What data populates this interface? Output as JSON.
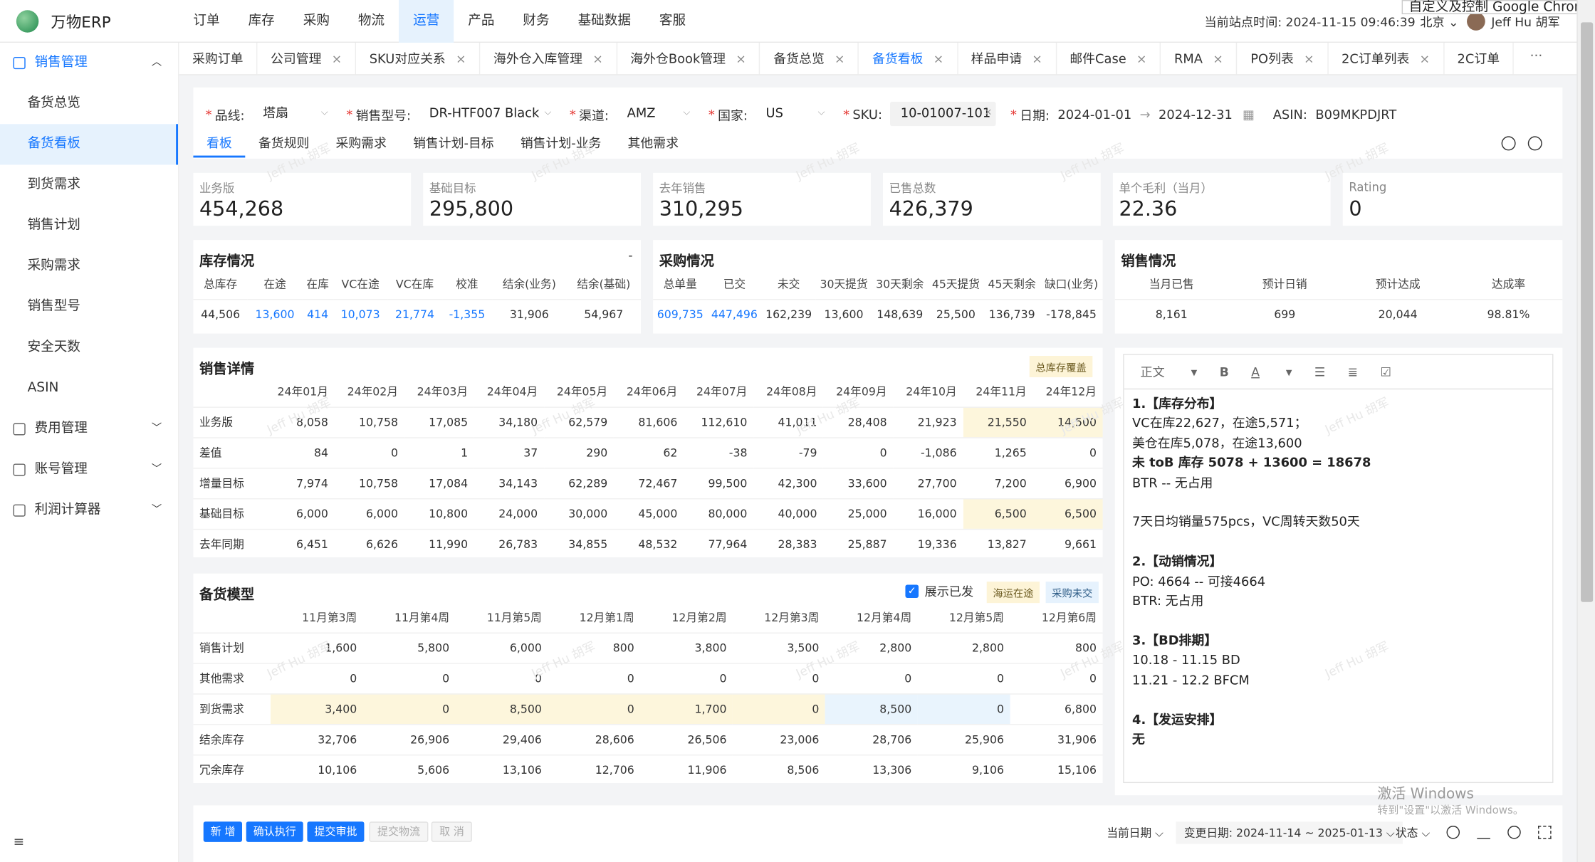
{
  "app": {
    "brand": "万物ERP",
    "site_time": "当前站点时间: 2024-11-15 09:46:39",
    "location": "北京",
    "user": "Jeff Hu 胡军",
    "chrome_tip": "自定义及控制 Google Chrome",
    "accent": "#1677ff"
  },
  "nav": [
    "订单",
    "库存",
    "采购",
    "物流",
    "运营",
    "产品",
    "财务",
    "基础数据",
    "客服"
  ],
  "nav_active": "运营",
  "sidebar": {
    "group1": "销售管理",
    "items": [
      "备货总览",
      "备货看板",
      "到货需求",
      "销售计划",
      "采购需求",
      "销售型号",
      "安全天数",
      "ASIN"
    ],
    "group2": "费用管理",
    "group3": "账号管理",
    "group4": "利润计算器",
    "collapse_icon": "≡"
  },
  "tabs": [
    "采购订单",
    "公司管理",
    "SKU对应关系",
    "海外仓入库管理",
    "海外仓Book管理",
    "备货总览",
    "备货看板",
    "样品申请",
    "邮件Case",
    "RMA",
    "PO列表",
    "2C订单列表",
    "2C订单"
  ],
  "tabs_more": "···",
  "filters": {
    "line_label": "品线:",
    "line": "塔扇",
    "model_label": "销售型号:",
    "model": "DR-HTF007 Black",
    "channel_label": "渠道:",
    "channel": "AMZ",
    "country_label": "国家:",
    "country": "US",
    "sku_label": "SKU:",
    "sku": "10-01007-101",
    "date_label": "日期:",
    "date_from": "2024-01-01",
    "date_to": "2024-12-31",
    "asin_label": "ASIN:",
    "asin": "B09MKPDJRT"
  },
  "subtabs": [
    "看板",
    "备货规则",
    "采购需求",
    "销售计划-目标",
    "销售计划-业务",
    "其他需求"
  ],
  "kpis": [
    {
      "label": "业务版",
      "value": "454,268"
    },
    {
      "label": "基础目标",
      "value": "295,800"
    },
    {
      "label": "去年销售",
      "value": "310,295"
    },
    {
      "label": "已售总数",
      "value": "426,379"
    },
    {
      "label": "单个毛利（当月）",
      "value": "22.36"
    },
    {
      "label": "Rating",
      "value": "0"
    }
  ],
  "inventory": {
    "title": "库存情况",
    "dash": "-",
    "headers": [
      "总库存",
      "在途",
      "在库",
      "VC在途",
      "VC在库",
      "校准",
      "结余(业务)",
      "结余(基础)"
    ],
    "values": [
      "44,506",
      "13,600",
      "414",
      "10,073",
      "21,774",
      "-1,355",
      "31,906",
      "54,967"
    ]
  },
  "purchase": {
    "title": "采购情况",
    "headers": [
      "总单量",
      "已交",
      "未交",
      "30天提货",
      "30天剩余",
      "45天提货",
      "45天剩余",
      "缺口(业务)"
    ],
    "values": [
      "609,735",
      "447,496",
      "162,239",
      "13,600",
      "148,639",
      "25,500",
      "136,739",
      "-178,845"
    ]
  },
  "sales": {
    "title": "销售情况",
    "headers": [
      "当月已售",
      "预计日销",
      "预计达成",
      "达成率"
    ],
    "values": [
      "8,161",
      "699",
      "20,044",
      "98.81%"
    ]
  },
  "detail": {
    "title": "销售详情",
    "badge": "总库存覆盖",
    "months": [
      "24年01月",
      "24年02月",
      "24年03月",
      "24年04月",
      "24年05月",
      "24年06月",
      "24年07月",
      "24年08月",
      "24年09月",
      "24年10月",
      "24年11月",
      "24年12月"
    ],
    "rows": [
      {
        "label": "业务版",
        "values": [
          "8,058",
          "10,758",
          "17,085",
          "34,180",
          "62,579",
          "81,606",
          "112,610",
          "41,011",
          "28,408",
          "21,923",
          "21,550",
          "14,500"
        ]
      },
      {
        "label": "差值",
        "values": [
          "84",
          "0",
          "1",
          "37",
          "290",
          "62",
          "-38",
          "-79",
          "0",
          "-1,086",
          "1,265",
          "0"
        ]
      },
      {
        "label": "增量目标",
        "values": [
          "7,974",
          "10,758",
          "17,084",
          "34,143",
          "62,289",
          "72,467",
          "99,500",
          "42,300",
          "33,600",
          "27,700",
          "7,200",
          "6,900"
        ]
      },
      {
        "label": "基础目标",
        "values": [
          "6,000",
          "6,000",
          "10,800",
          "24,000",
          "30,000",
          "45,000",
          "80,000",
          "40,000",
          "25,000",
          "16,000",
          "6,500",
          "6,500"
        ]
      },
      {
        "label": "去年同期",
        "values": [
          "6,451",
          "6,626",
          "11,990",
          "26,783",
          "34,855",
          "48,532",
          "77,964",
          "28,383",
          "25,887",
          "19,336",
          "13,827",
          "9,661"
        ]
      }
    ]
  },
  "model": {
    "title": "备货模型",
    "show_shipped": "展示已发",
    "badge1": "海运在途",
    "badge2": "采购未交",
    "weeks": [
      "11月第3周",
      "11月第4周",
      "11月第5周",
      "12月第1周",
      "12月第2周",
      "12月第3周",
      "12月第4周",
      "12月第5周",
      "12月第6周"
    ],
    "rows": [
      {
        "label": "销售计划",
        "values": [
          "1,600",
          "5,800",
          "6,000",
          "800",
          "3,800",
          "3,500",
          "2,800",
          "2,800",
          "800"
        ]
      },
      {
        "label": "其他需求",
        "values": [
          "0",
          "0",
          "0",
          "0",
          "0",
          "0",
          "0",
          "0",
          "0"
        ]
      },
      {
        "label": "到货需求",
        "values": [
          "3,400",
          "0",
          "8,500",
          "0",
          "1,700",
          "0",
          "8,500",
          "0",
          "6,800"
        ]
      },
      {
        "label": "结余库存",
        "values": [
          "32,706",
          "26,906",
          "29,406",
          "28,606",
          "26,506",
          "23,006",
          "28,706",
          "25,906",
          "31,906"
        ]
      },
      {
        "label": "冗余库存",
        "values": [
          "10,106",
          "5,606",
          "13,106",
          "12,706",
          "11,906",
          "8,506",
          "13,306",
          "9,106",
          "15,106"
        ]
      }
    ]
  },
  "editor": {
    "toolbar": {
      "style": "正文",
      "bold": "B",
      "color": "A"
    },
    "lines": [
      {
        "text": "1.【库存分布】",
        "bold": true
      },
      {
        "text": "VC在库22,627，在途5,571；",
        "bold": false
      },
      {
        "text": "美仓在库5,078，在途13,600",
        "bold": false
      },
      {
        "text": "未 toB 库存 5078 + 13600 = 18678",
        "bold": true
      },
      {
        "text": "BTR -- 无占用",
        "bold": false
      },
      {
        "text": "",
        "bold": false
      },
      {
        "text": "7天日均销量575pcs，VC周转天数50天",
        "bold": false
      },
      {
        "text": "",
        "bold": false
      },
      {
        "text": "2.【动销情况】",
        "bold": true
      },
      {
        "text": "PO: 4664 -- 可接4664",
        "bold": false,
        "prefix": "PO:"
      },
      {
        "text": "BTR: 无占用",
        "bold": false,
        "prefix": "BTR:"
      },
      {
        "text": "",
        "bold": false
      },
      {
        "text": "3.【BD排期】",
        "bold": true
      },
      {
        "text": "10.18 - 11.15 BD",
        "bold": false
      },
      {
        "text": "11.21 - 12.2 BFCM",
        "bold": false
      },
      {
        "text": "",
        "bold": false
      },
      {
        "text": "4.【发运安排】",
        "bold": true
      },
      {
        "text": "无",
        "bold": true
      }
    ]
  },
  "bottom": {
    "btn_new": "新 增",
    "btn_confirm": "确认执行",
    "btn_submit": "提交审批",
    "btn_logistics": "提交物流",
    "btn_cancel": "取 消",
    "current_date": "当前日期",
    "change_date": "变更日期: 2024-11-14 ~ 2025-01-13",
    "status": "状态"
  },
  "watermark": "Jeff Hu 胡军",
  "windows": {
    "line1": "激活 Windows",
    "line2": "转到\"设置\"以激活 Windows。"
  }
}
